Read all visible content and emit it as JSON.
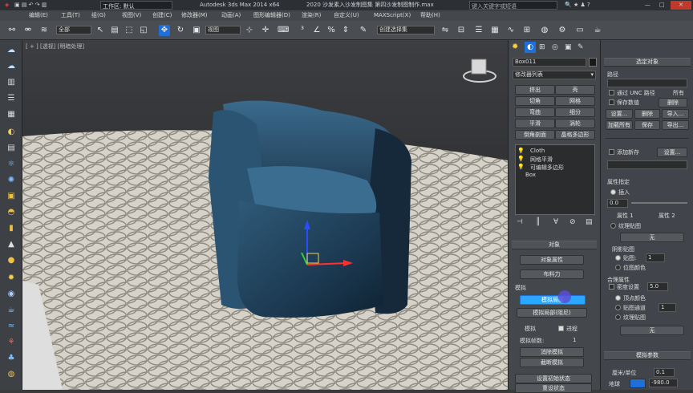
{
  "title_bar": {
    "workspace": "工作区: 默认",
    "app_title": "Autodesk 3ds Max 2014 x64",
    "file_title": "2020 沙发素入沙发制图集 第四沙发制图制作.max",
    "search_placeholder": "键入关键字或短语"
  },
  "menu": {
    "items": [
      "编辑(E)",
      "工具(T)",
      "组(G)",
      "视图(V)",
      "创建(C)",
      "修改器(M)",
      "动画(A)",
      "图形编辑器(D)",
      "渲染(R)",
      "自定义(U)",
      "MAXScript(X)",
      "帮助(H)"
    ]
  },
  "toolbar": {
    "filter_value": "全部",
    "view_value": "视图",
    "selection_set": "创建选择集"
  },
  "viewport": {
    "label": "[ + ] [透视] [明暗处理]"
  },
  "command_panel": {
    "object_name": "Box011",
    "modifier_list": "修改器列表",
    "btn_row1": [
      "挤出",
      "壳"
    ],
    "btn_row2": [
      "切角",
      "网格"
    ],
    "btn_row3": [
      "弯曲",
      "细分"
    ],
    "btn_row4": [
      "平滑",
      "涡轮"
    ],
    "btn_row5": [
      "倒角剖面",
      "晶格多边形"
    ],
    "stack": [
      "Cloth",
      "网格平滑",
      "可编辑多边形",
      "Box"
    ],
    "rollout_object": "对象",
    "object_props_btn": "对象属性",
    "cloth_forces_btn": "布料力",
    "simulation_label": "模拟",
    "sim_local_btn": "模拟局部",
    "sim_local_damped_btn": "模拟局部(阻尼)",
    "simulate_label": "模拟",
    "progress_label": "进程",
    "sim_frames_label": "模拟帧数:",
    "sim_frames_value": "1",
    "erase_sim_btn": "消除模拟",
    "truncate_sim_btn": "截断模拟",
    "set_initial_btn": "设置初始状态",
    "reset_state_btn": "重设状态"
  },
  "right_panel": {
    "header": "选定对象",
    "group_label": "路径",
    "chk_unc": "通过 UNC 路径",
    "chk_all": "所有",
    "chk_save": "保存数值",
    "btn_settings": "设置...",
    "btn_delete": "删除",
    "btn_import": "导入...",
    "btn_load_new": "加载所有",
    "btn_preserve": "保存",
    "btn_export": "导出...",
    "chk_add_new": "添加新存",
    "btn_settings2": "设置...",
    "group_props": "属性指定",
    "radio_insert": "插入",
    "insert_value": "0.0",
    "attr1_label": "属性 1",
    "attr2_label": "属性 2",
    "chk_texture": "纹理贴图",
    "none_btn": "无",
    "group_tiling": "阴影贴图",
    "radio_tiling": "贴图:",
    "tiling_value": "1",
    "radio_bitmap": "位图颜色",
    "group_cloth": "合理属性",
    "chk_density": "密度设置",
    "density_value": "5.0",
    "radio_vertex": "顶点颜色",
    "radio_channel": "贴图通道",
    "channel_value": "1",
    "radio_texture2": "纹理贴图",
    "none_btn2": "无",
    "rollout_sim": "模拟参数",
    "unit_label": "厘米/单位",
    "unit_value": "0.1",
    "earth_label": "地球",
    "gravity_value": "-980.0"
  },
  "colors": {
    "accent_blue": "#1e6fd8",
    "highlight_cyan": "#2aa7ff",
    "chair_color": "#1f3e55",
    "floor_color": "#d9d5cc"
  }
}
